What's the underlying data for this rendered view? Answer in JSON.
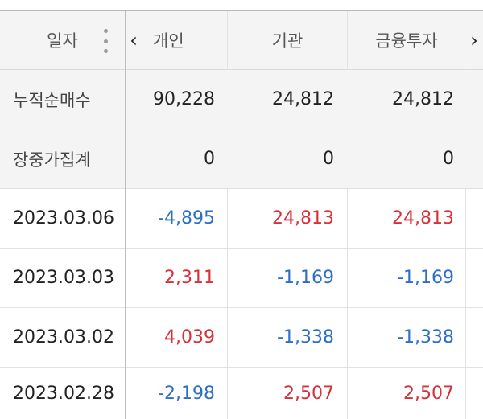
{
  "header": {
    "date_label": "일자",
    "columns": [
      "개인",
      "기관",
      "금융투자"
    ],
    "more_icon": "kebab-vertical-icon",
    "prev_icon": "chevron-left-icon",
    "next_icon": "chevron-right-icon"
  },
  "summary_rows": [
    {
      "label": "누적순매수",
      "indiv": "90,228",
      "inst": "24,812",
      "fin": "24,812"
    },
    {
      "label": "장중가집계",
      "indiv": "0",
      "inst": "0",
      "fin": "0"
    }
  ],
  "rows": [
    {
      "date": "2023.03.06",
      "indiv": "-4,895",
      "inst": "24,813",
      "fin": "24,813"
    },
    {
      "date": "2023.03.03",
      "indiv": "2,311",
      "inst": "-1,169",
      "fin": "-1,169"
    },
    {
      "date": "2023.03.02",
      "indiv": "4,039",
      "inst": "-1,338",
      "fin": "-1,338"
    },
    {
      "date": "2023.02.28",
      "indiv": "-2,198",
      "inst": "2,507",
      "fin": "2,507"
    }
  ],
  "colors": {
    "positive": "#d8303b",
    "negative": "#2c6fc9",
    "header_bg": "#f4f4f4"
  }
}
